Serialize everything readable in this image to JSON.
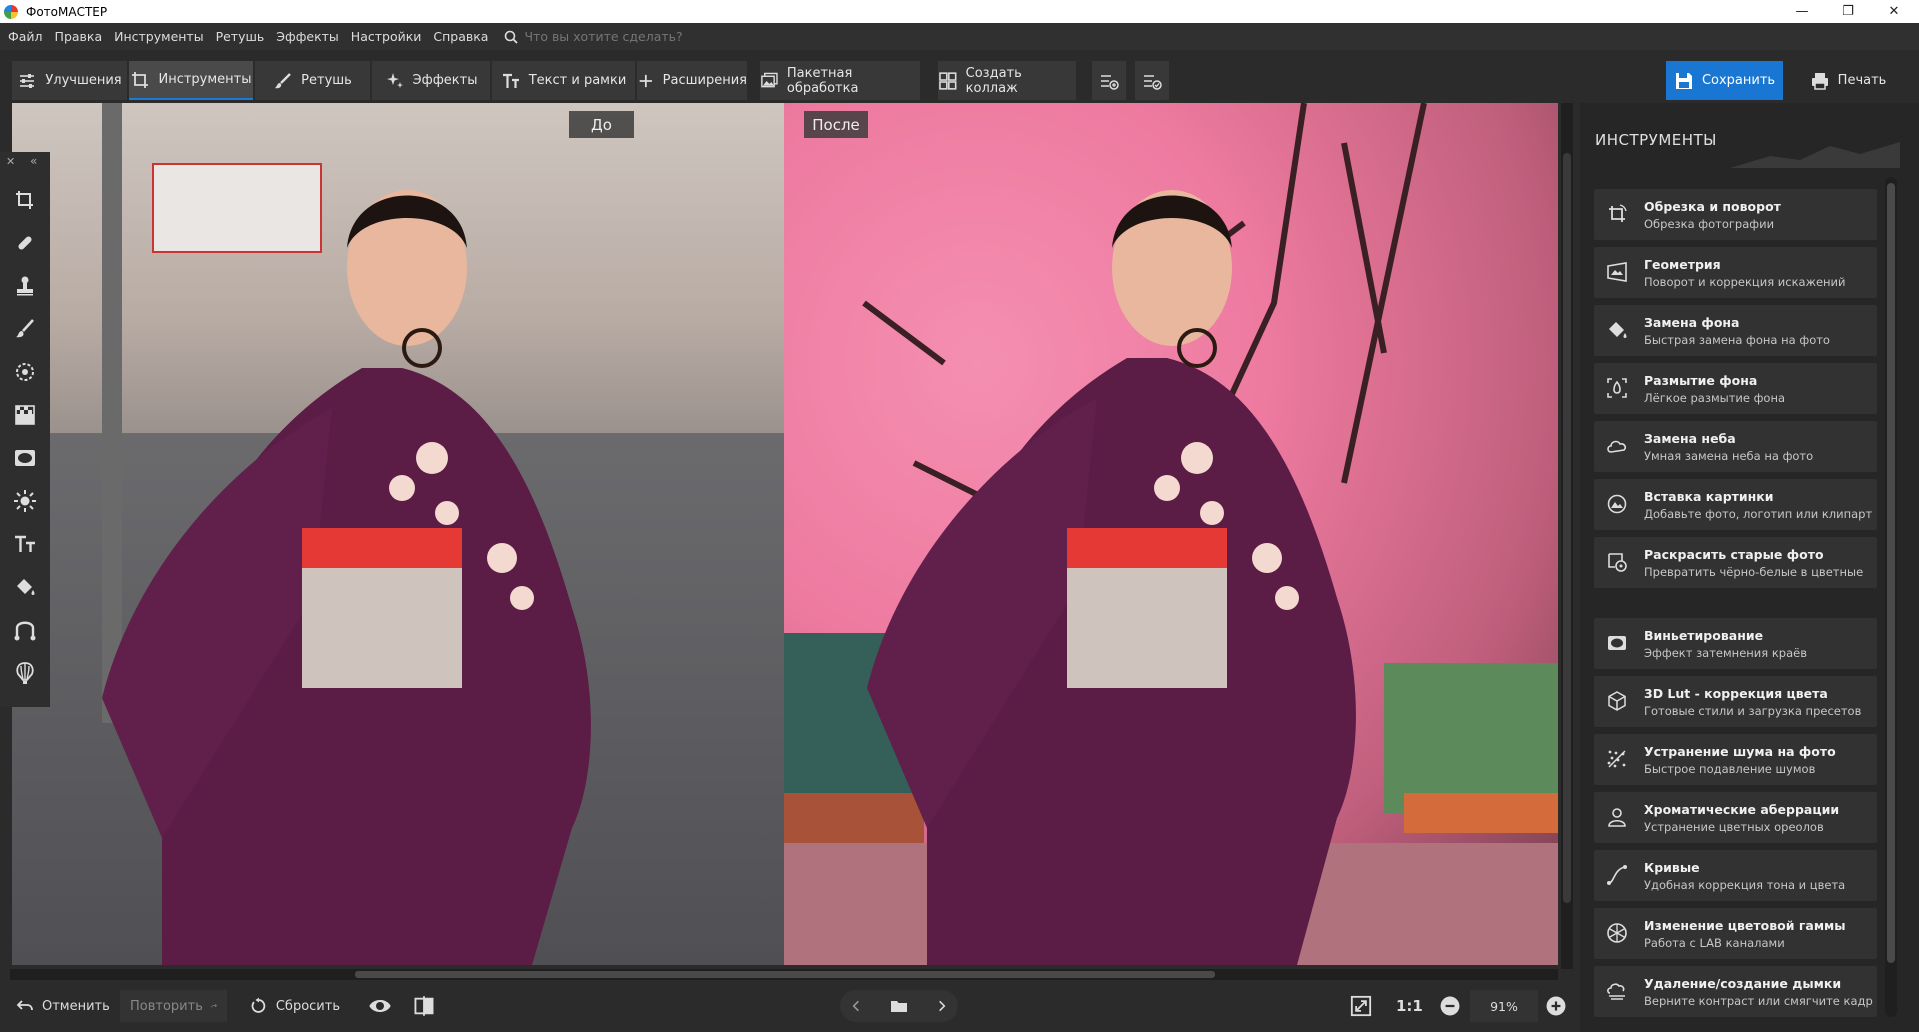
{
  "window": {
    "title": "ФотоМАСТЕР",
    "min_glyph": "—",
    "max_glyph": "❐",
    "close_glyph": "✕"
  },
  "menu": {
    "items": [
      "Файл",
      "Правка",
      "Инструменты",
      "Ретушь",
      "Эффекты",
      "Настройки",
      "Справка"
    ],
    "search_placeholder": "Что вы хотите сделать?"
  },
  "toolbar": {
    "tabs": [
      {
        "label": "Улучшения",
        "icon": "sliders-icon"
      },
      {
        "label": "Инструменты",
        "icon": "crop-icon",
        "active": true
      },
      {
        "label": "Ретушь",
        "icon": "brush-icon"
      },
      {
        "label": "Эффекты",
        "icon": "sparkle-icon"
      },
      {
        "label": "Текст и рамки",
        "icon": "text-icon"
      },
      {
        "label": "Расширения",
        "icon": "plus-icon"
      }
    ],
    "batch_label": "Пакетная обработка",
    "collage_label": "Создать коллаж",
    "save_label": "Сохранить",
    "print_label": "Печать"
  },
  "canvas": {
    "before_label": "До",
    "after_label": "После"
  },
  "panel": {
    "title": "ИНСТРУМЕНТЫ",
    "tools": [
      {
        "name": "Обрезка и поворот",
        "desc": "Обрезка фотографии",
        "icon": "crop-rotate-icon"
      },
      {
        "name": "Геометрия",
        "desc": "Поворот и коррекция искажений",
        "icon": "geometry-icon"
      },
      {
        "name": "Замена фона",
        "desc": "Быстрая замена фона на фото",
        "icon": "bucket-icon"
      },
      {
        "name": "Размытие фона",
        "desc": "Лёгкое размытие фона",
        "icon": "blur-icon"
      },
      {
        "name": "Замена неба",
        "desc": "Умная замена неба на фото",
        "icon": "cloud-icon"
      },
      {
        "name": "Вставка картинки",
        "desc": "Добавьте фото, логотип или клипарт",
        "icon": "insert-image-icon"
      },
      {
        "name": "Раскрасить старые фото",
        "desc": "Превратить чёрно-белые в цветные",
        "icon": "colorize-icon"
      },
      {
        "name": "Виньетирование",
        "desc": "Эффект затемнения краёв",
        "icon": "vignette-icon"
      },
      {
        "name": "3D Lut - коррекция цвета",
        "desc": "Готовые стили и загрузка пресетов",
        "icon": "cube-icon"
      },
      {
        "name": "Устранение шума на фото",
        "desc": "Быстрое подавление шумов",
        "icon": "noise-icon"
      },
      {
        "name": "Хроматические аберрации",
        "desc": "Устранение цветных ореолов",
        "icon": "aberration-icon"
      },
      {
        "name": "Кривые",
        "desc": "Удобная коррекция тона и цвета",
        "icon": "curves-icon"
      },
      {
        "name": "Изменение цветовой гаммы",
        "desc": "Работа с LAB каналами",
        "icon": "color-wheel-icon"
      },
      {
        "name": "Удаление/создание дымки",
        "desc": "Верните контраст или смягчите кадр",
        "icon": "haze-icon"
      }
    ]
  },
  "bottom": {
    "undo_label": "Отменить",
    "redo_label": "Повторить",
    "reset_label": "Сбросить",
    "zoom_1to1": "1:1",
    "zoom_value": "91%"
  }
}
